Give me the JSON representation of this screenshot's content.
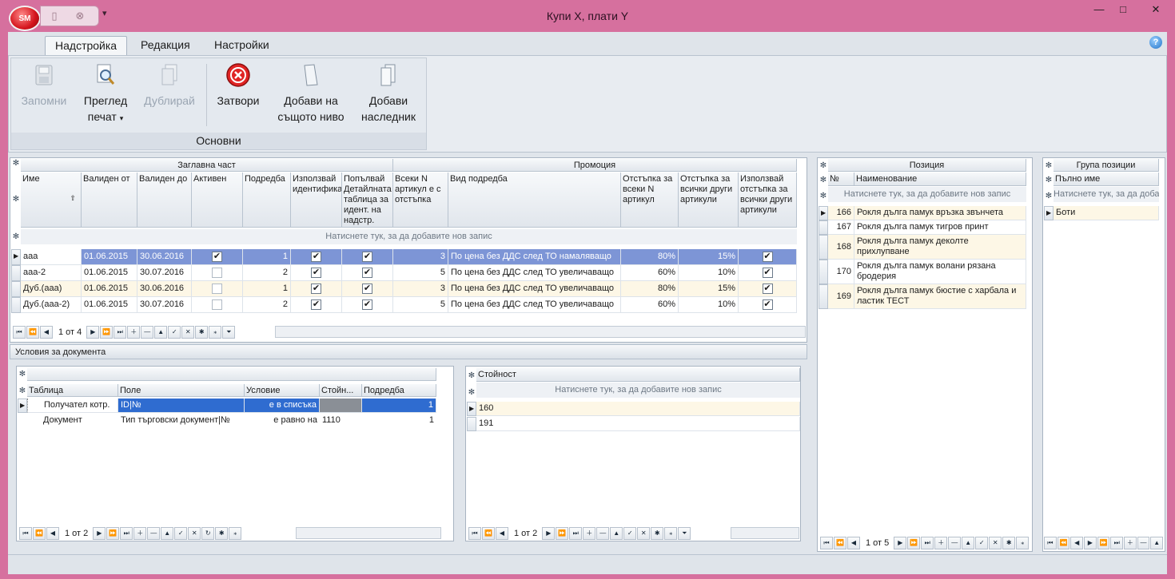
{
  "window": {
    "title": "Купи X, плати Y",
    "logo_text": "SM",
    "minimize": "—",
    "maximize": "□",
    "close": "✕"
  },
  "ribbon": {
    "tabs": [
      "Надстройка",
      "Редакция",
      "Настройки"
    ],
    "group_label": "Основни",
    "buttons": {
      "save": "Запомни",
      "preview_l1": "Преглед",
      "preview_l2": "печат",
      "duplicate": "Дублирай",
      "close": "Затвори",
      "add_same_l1": "Добави на",
      "add_same_l2": "същото ниво",
      "add_child_l1": "Добави",
      "add_child_l2": "наследник"
    }
  },
  "main_grid": {
    "band_header": "Заглавна част",
    "band_promo": "Промоция",
    "columns": [
      "Име",
      "Валиден от",
      "Валиден до",
      "Активен",
      "Подредба",
      "Използвай идентификатора",
      "Попълвай Детайлната таблица за идент. на надстр.",
      "Всеки N артикул е с отстъпка",
      "Вид подредба",
      "Отстъпка за всеки N артикул",
      "Отстъпка за всички други артикули",
      "Използвай отстъпка за всички други артикули"
    ],
    "new_row": "Натиснете тук, за да добавите нов запис",
    "rows": [
      {
        "name": "aaa",
        "from": "01.06.2015",
        "to": "30.06.2016",
        "active": true,
        "order": "1",
        "use_id": true,
        "fill": true,
        "n": "3",
        "kind": "По цена без ДДС след ТО намаляващо",
        "disc_n": "80%",
        "disc_other": "15%",
        "use_other": true
      },
      {
        "name": "aaa-2",
        "from": "01.06.2015",
        "to": "30.07.2016",
        "active": false,
        "order": "2",
        "use_id": true,
        "fill": true,
        "n": "5",
        "kind": "По цена без ДДС след ТО увеличаващо",
        "disc_n": "60%",
        "disc_other": "10%",
        "use_other": true
      },
      {
        "name": "Дуб.(aaa)",
        "from": "01.06.2015",
        "to": "30.06.2016",
        "active": false,
        "order": "1",
        "use_id": true,
        "fill": true,
        "n": "3",
        "kind": "По цена без ДДС след ТО увеличаващо",
        "disc_n": "80%",
        "disc_other": "15%",
        "use_other": true
      },
      {
        "name": "Дуб.(aaa-2)",
        "from": "01.06.2015",
        "to": "30.07.2016",
        "active": false,
        "order": "2",
        "use_id": true,
        "fill": true,
        "n": "5",
        "kind": "По цена без ДДС след ТО увеличаващо",
        "disc_n": "60%",
        "disc_other": "10%",
        "use_other": true
      }
    ],
    "nav_text": "1 от 4"
  },
  "conditions": {
    "title": "Условия за документа",
    "columns": [
      "Таблица",
      "Поле",
      "Условие",
      "Стойн...",
      "Подредба"
    ],
    "rows": [
      {
        "table": "Получател котр.",
        "field": "ID|№",
        "cond": "е в списъка",
        "value": "",
        "order": "1"
      },
      {
        "table": "Документ",
        "field": "Тип търговски документ|№",
        "cond": "е равно на",
        "value": "1110",
        "order": "1"
      }
    ],
    "nav_text": "1 от 2"
  },
  "values": {
    "column": "Стойност",
    "new_row": "Натиснете тук, за да добавите нов запис",
    "rows": [
      "160",
      "191"
    ],
    "nav_text": "1 от 2"
  },
  "positions": {
    "title": "Позиция",
    "columns": [
      "№",
      "Наименование"
    ],
    "new_row": "Натиснете тук, за да добавите нов запис",
    "rows": [
      {
        "no": "166",
        "name": "Рокля дълга памук връзка звънчета"
      },
      {
        "no": "167",
        "name": "Рокля дълга памук тигров принт"
      },
      {
        "no": "168",
        "name": "Рокля дълга  памук деколте прихлупване"
      },
      {
        "no": "170",
        "name": "Рокля дълга памук волани рязана бродерия"
      },
      {
        "no": "169",
        "name": "Рокля дълга памук бюстие с харбала и ластик ТЕСТ"
      }
    ],
    "nav_text": "1 от 5"
  },
  "groups": {
    "title": "Група позиции",
    "column": "Пълно име",
    "new_row": "Натиснете тук, за да добавите нов запис",
    "rows": [
      "Боти"
    ]
  },
  "colors": {
    "frame": "#d6709e",
    "selection": "#7d95d6",
    "cond_selection": "#2f6cd0",
    "alt_row": "#fdf7e6"
  }
}
